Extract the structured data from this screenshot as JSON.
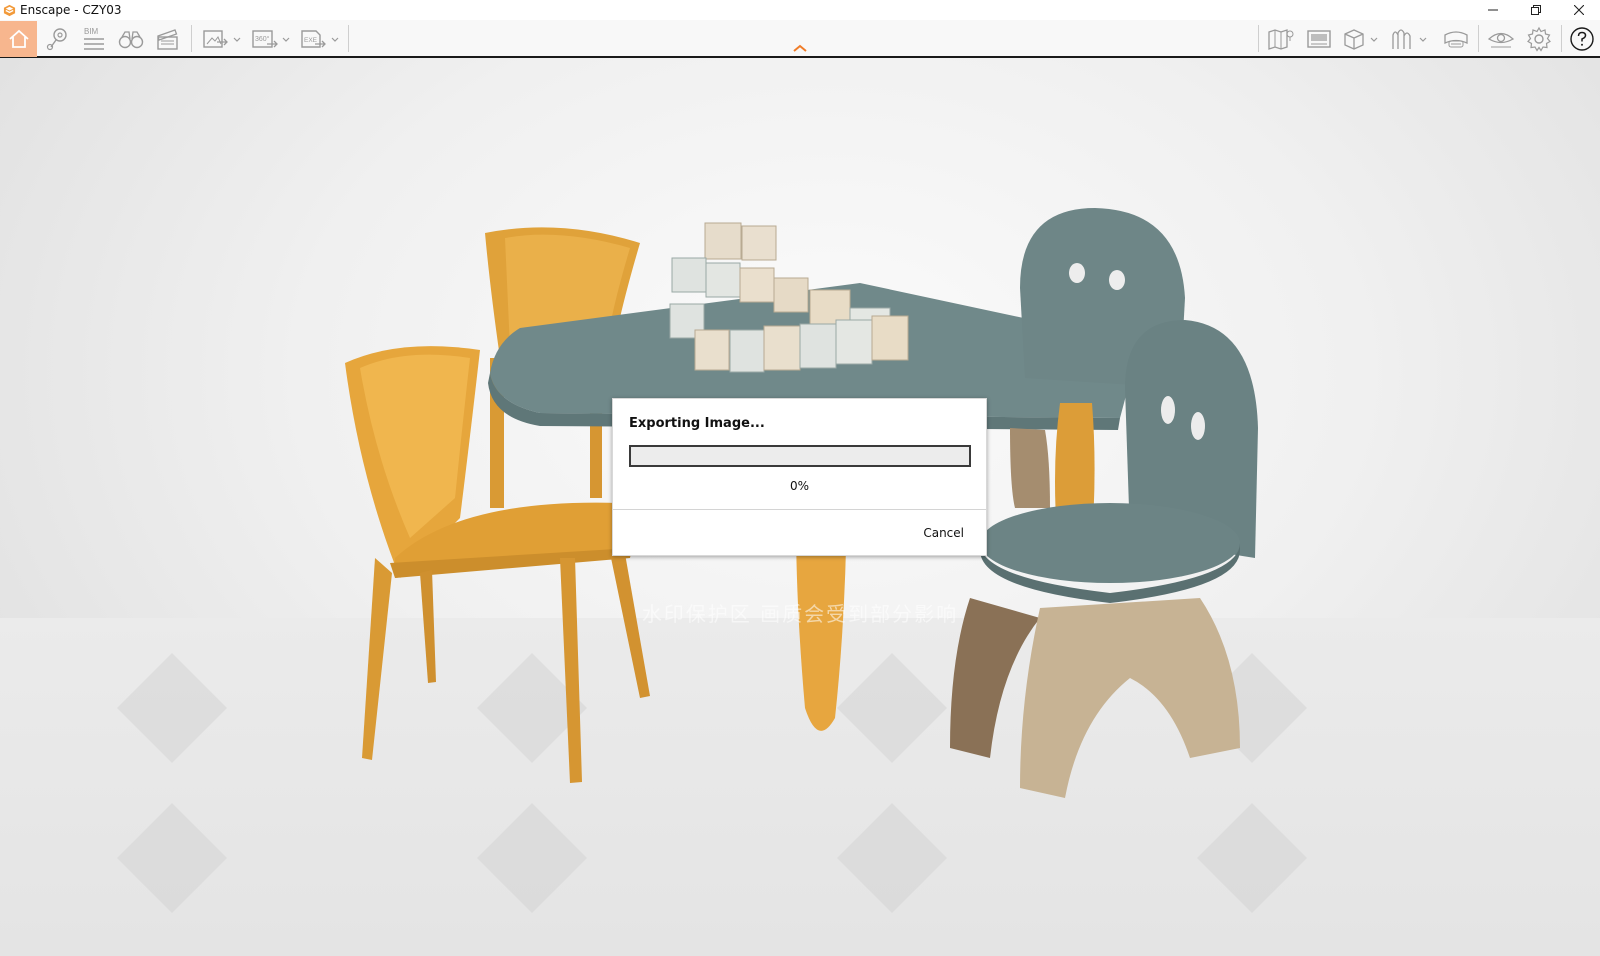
{
  "window": {
    "title": "Enscape - CZY03",
    "accent": "#f7b68e"
  },
  "toolbar": {
    "left_icons": [
      "home-icon",
      "location-pin-icon",
      "bim-icon",
      "binoculars-icon",
      "clapperboard-icon",
      "screenshot-export-icon",
      "panorama-360-export-icon",
      "exe-export-icon"
    ],
    "bim_label": "BIM",
    "pano_label": "360°",
    "exe_label": "EXE",
    "right_icons": [
      "map-icon",
      "video-editor-icon",
      "cube-view-icon",
      "asset-library-icon",
      "vr-headset-icon",
      "eye-icon",
      "settings-icon",
      "help-icon"
    ]
  },
  "viewport": {
    "watermark_text": "水印保护区  画质会受到部分影响",
    "watermark_logo": "知末"
  },
  "dialog": {
    "title": "Exporting Image...",
    "progress_fraction": 0,
    "progress_text": "0%",
    "cancel_label": "Cancel"
  }
}
